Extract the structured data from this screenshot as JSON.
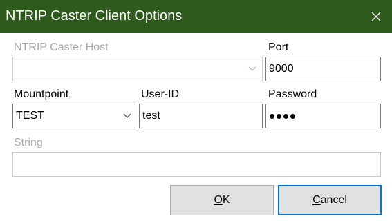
{
  "window": {
    "title": "NTRIP Caster Client Options",
    "close_icon": "close-icon"
  },
  "host": {
    "label": "NTRIP Caster Host",
    "value": "",
    "disabled": true
  },
  "port": {
    "label": "Port",
    "value": "9000"
  },
  "mountpoint": {
    "label": "Mountpoint",
    "value": "TEST"
  },
  "userid": {
    "label": "User-ID",
    "value": "test"
  },
  "password": {
    "label": "Password",
    "masked_length": 4
  },
  "string": {
    "label": "String",
    "value": "",
    "disabled": true
  },
  "buttons": {
    "ok": {
      "mnemonic": "O",
      "rest": "K"
    },
    "cancel": {
      "mnemonic": "C",
      "rest": "ancel"
    }
  },
  "colors": {
    "titlebar": "#2e5a1c",
    "focus_border": "#0078d7",
    "disabled_text": "#a8a8a8"
  }
}
